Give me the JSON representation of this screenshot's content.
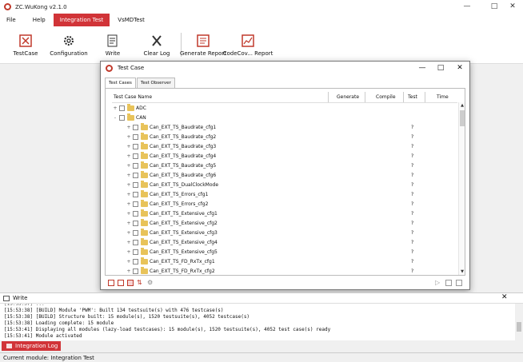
{
  "app": {
    "title": "ZC.WuKong v2.1.0"
  },
  "menu": {
    "items": [
      "File",
      "Help",
      "Integration Test",
      "VsMDTest"
    ],
    "active": "Integration Test"
  },
  "ribbon": {
    "buttons": [
      {
        "label": "TestCase",
        "icon": "testcase-icon"
      },
      {
        "label": "Configuration",
        "icon": "gear-icon"
      },
      {
        "label": "Write",
        "icon": "write-icon"
      },
      {
        "label": "Clear Log",
        "icon": "clear-log-icon"
      },
      {
        "label": "Generate Report",
        "icon": "report-icon"
      },
      {
        "label": "CodeCov... Report",
        "icon": "codecov-report-icon"
      }
    ]
  },
  "dialog": {
    "title": "Test Case",
    "tabs": [
      "Test Cases",
      "Test Observer"
    ],
    "columns": [
      "Test Case Name",
      "Generate",
      "Compile",
      "Test",
      "Time"
    ],
    "rows": [
      {
        "label": "ADC",
        "level": 0,
        "expander": "+",
        "test": ""
      },
      {
        "label": "CAN",
        "level": 0,
        "expander": "-",
        "test": ""
      },
      {
        "label": "Can_EXT_TS_Baudrate_cfg1",
        "level": 1,
        "expander": "+",
        "test": "?"
      },
      {
        "label": "Can_EXT_TS_Baudrate_cfg2",
        "level": 1,
        "expander": "+",
        "test": "?"
      },
      {
        "label": "Can_EXT_TS_Baudrate_cfg3",
        "level": 1,
        "expander": "+",
        "test": "?"
      },
      {
        "label": "Can_EXT_TS_Baudrate_cfg4",
        "level": 1,
        "expander": "+",
        "test": "?"
      },
      {
        "label": "Can_EXT_TS_Baudrate_cfg5",
        "level": 1,
        "expander": "+",
        "test": "?"
      },
      {
        "label": "Can_EXT_TS_Baudrate_cfg6",
        "level": 1,
        "expander": "+",
        "test": "?"
      },
      {
        "label": "Can_EXT_TS_DualClockMode",
        "level": 1,
        "expander": "+",
        "test": "?"
      },
      {
        "label": "Can_EXT_TS_Errors_cfg1",
        "level": 1,
        "expander": "+",
        "test": "?"
      },
      {
        "label": "Can_EXT_TS_Errors_cfg2",
        "level": 1,
        "expander": "+",
        "test": "?"
      },
      {
        "label": "Can_EXT_TS_Extensive_cfg1",
        "level": 1,
        "expander": "+",
        "test": "?"
      },
      {
        "label": "Can_EXT_TS_Extensive_cfg2",
        "level": 1,
        "expander": "+",
        "test": "?"
      },
      {
        "label": "Can_EXT_TS_Extensive_cfg3",
        "level": 1,
        "expander": "+",
        "test": "?"
      },
      {
        "label": "Can_EXT_TS_Extensive_cfg4",
        "level": 1,
        "expander": "+",
        "test": "?"
      },
      {
        "label": "Can_EXT_TS_Extensive_cfg5",
        "level": 1,
        "expander": "+",
        "test": "?"
      },
      {
        "label": "Can_EXT_TS_FD_RxTx_cfg1",
        "level": 1,
        "expander": "+",
        "test": "?"
      },
      {
        "label": "Can_EXT_TS_FD_RxTx_cfg2",
        "level": 1,
        "expander": "+",
        "test": "?"
      }
    ]
  },
  "write_panel": {
    "title": "Write",
    "lines": [
      "[15:53:38] [BUILD] Module 'PWM': Built 134 testsuite(s) with 476 testcase(s)",
      "[15:53:38] [BUILD] Structure built: 15 module(s), 1520 testsuite(s), 4052 testcase(s)",
      "[15:53:38] Loading complete: 15 module",
      "[15:53:41] Displaying all modules (lazy-load testcases): 15 module(s), 1520 testsuite(s), 4052 test case(s) ready",
      "[15:53:41] Module activated"
    ]
  },
  "bottom_tab": {
    "label": "Integration Log"
  },
  "status": {
    "text": "Current module: Integration Test"
  },
  "colors": {
    "accent": "#d13438",
    "folder": "#e8c35a"
  }
}
